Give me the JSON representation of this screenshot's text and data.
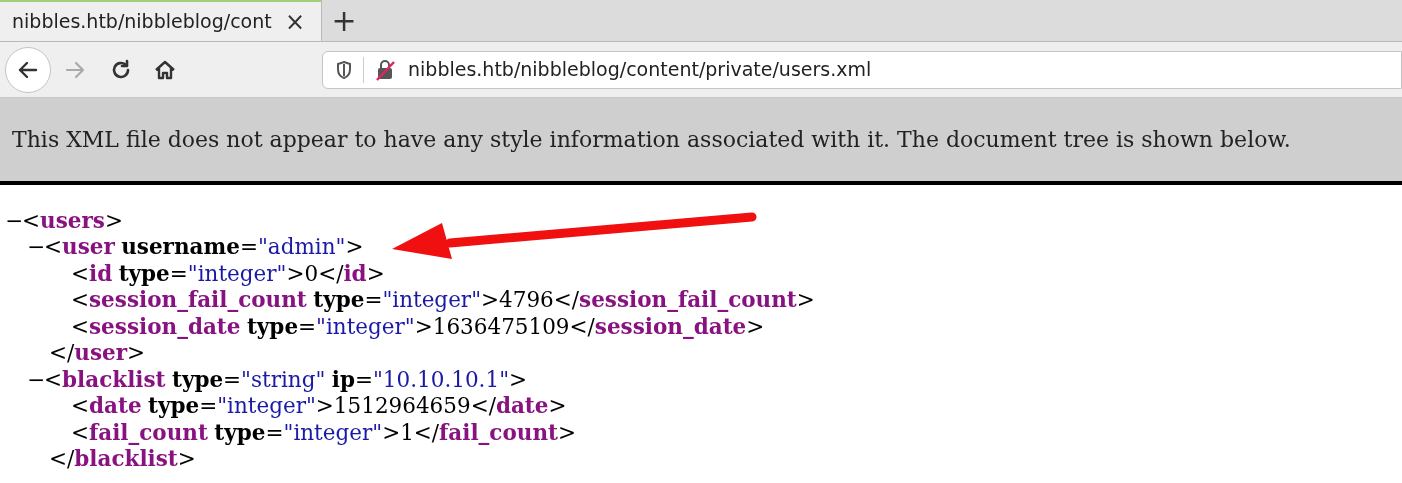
{
  "tab": {
    "title": "nibbles.htb/nibbleblog/cont",
    "selected": true,
    "close": "×"
  },
  "new_tab": "+",
  "address_bar": {
    "url": "nibbles.htb/nibbleblog/content/private/users.xml",
    "insecure": true
  },
  "info_message": "This XML file does not appear to have any style information associated with it. The document tree is shown below.",
  "xml_tree": [
    {
      "toggle": "−",
      "tokens": [
        {
          "kind": "punct",
          "text": "<"
        },
        {
          "kind": "tag",
          "text": "users"
        },
        {
          "kind": "punct",
          "text": ">"
        }
      ],
      "children": [
        {
          "toggle": "−",
          "tokens": [
            {
              "kind": "punct",
              "text": "<"
            },
            {
              "kind": "tag",
              "text": "user"
            },
            {
              "kind": "attr",
              "text": "username"
            },
            {
              "kind": "punct",
              "text": "="
            },
            {
              "kind": "value",
              "text": "\"admin\""
            },
            {
              "kind": "punct",
              "text": ">"
            }
          ],
          "children": [
            {
              "tokens": [
                {
                  "kind": "punct",
                  "text": "<"
                },
                {
                  "kind": "tag",
                  "text": "id"
                },
                {
                  "kind": "attr",
                  "text": "type"
                },
                {
                  "kind": "punct",
                  "text": "="
                },
                {
                  "kind": "value",
                  "text": "\"integer\""
                },
                {
                  "kind": "punct",
                  "text": ">"
                },
                {
                  "kind": "text",
                  "text": "0"
                },
                {
                  "kind": "punct",
                  "text": "</"
                },
                {
                  "kind": "tag",
                  "text": "id"
                },
                {
                  "kind": "punct",
                  "text": ">"
                }
              ]
            },
            {
              "tokens": [
                {
                  "kind": "punct",
                  "text": "<"
                },
                {
                  "kind": "tag",
                  "text": "session_fail_count"
                },
                {
                  "kind": "attr",
                  "text": "type"
                },
                {
                  "kind": "punct",
                  "text": "="
                },
                {
                  "kind": "value",
                  "text": "\"integer\""
                },
                {
                  "kind": "punct",
                  "text": ">"
                },
                {
                  "kind": "text",
                  "text": "4796"
                },
                {
                  "kind": "punct",
                  "text": "</"
                },
                {
                  "kind": "tag",
                  "text": "session_fail_count"
                },
                {
                  "kind": "punct",
                  "text": ">"
                }
              ]
            },
            {
              "tokens": [
                {
                  "kind": "punct",
                  "text": "<"
                },
                {
                  "kind": "tag",
                  "text": "session_date"
                },
                {
                  "kind": "attr",
                  "text": "type"
                },
                {
                  "kind": "punct",
                  "text": "="
                },
                {
                  "kind": "value",
                  "text": "\"integer\""
                },
                {
                  "kind": "punct",
                  "text": ">"
                },
                {
                  "kind": "text",
                  "text": "1636475109"
                },
                {
                  "kind": "punct",
                  "text": "</"
                },
                {
                  "kind": "tag",
                  "text": "session_date"
                },
                {
                  "kind": "punct",
                  "text": ">"
                }
              ]
            }
          ],
          "closing": [
            {
              "kind": "punct",
              "text": "</"
            },
            {
              "kind": "tag",
              "text": "user"
            },
            {
              "kind": "punct",
              "text": ">"
            }
          ]
        },
        {
          "toggle": "−",
          "tokens": [
            {
              "kind": "punct",
              "text": "<"
            },
            {
              "kind": "tag",
              "text": "blacklist"
            },
            {
              "kind": "attr",
              "text": "type"
            },
            {
              "kind": "punct",
              "text": "="
            },
            {
              "kind": "value",
              "text": "\"string\""
            },
            {
              "kind": "attr",
              "text": "ip"
            },
            {
              "kind": "punct",
              "text": "="
            },
            {
              "kind": "value",
              "text": "\"10.10.10.1\""
            },
            {
              "kind": "punct",
              "text": ">"
            }
          ],
          "children": [
            {
              "tokens": [
                {
                  "kind": "punct",
                  "text": "<"
                },
                {
                  "kind": "tag",
                  "text": "date"
                },
                {
                  "kind": "attr",
                  "text": "type"
                },
                {
                  "kind": "punct",
                  "text": "="
                },
                {
                  "kind": "value",
                  "text": "\"integer\""
                },
                {
                  "kind": "punct",
                  "text": ">"
                },
                {
                  "kind": "text",
                  "text": "1512964659"
                },
                {
                  "kind": "punct",
                  "text": "</"
                },
                {
                  "kind": "tag",
                  "text": "date"
                },
                {
                  "kind": "punct",
                  "text": ">"
                }
              ]
            },
            {
              "tokens": [
                {
                  "kind": "punct",
                  "text": "<"
                },
                {
                  "kind": "tag",
                  "text": "fail_count"
                },
                {
                  "kind": "attr",
                  "text": "type"
                },
                {
                  "kind": "punct",
                  "text": "="
                },
                {
                  "kind": "value",
                  "text": "\"integer\""
                },
                {
                  "kind": "punct",
                  "text": ">"
                },
                {
                  "kind": "text",
                  "text": "1"
                },
                {
                  "kind": "punct",
                  "text": "</"
                },
                {
                  "kind": "tag",
                  "text": "fail_count"
                },
                {
                  "kind": "punct",
                  "text": ">"
                }
              ]
            }
          ],
          "closing": [
            {
              "kind": "punct",
              "text": "</"
            },
            {
              "kind": "tag",
              "text": "blacklist"
            },
            {
              "kind": "punct",
              "text": ">"
            }
          ]
        }
      ]
    }
  ]
}
